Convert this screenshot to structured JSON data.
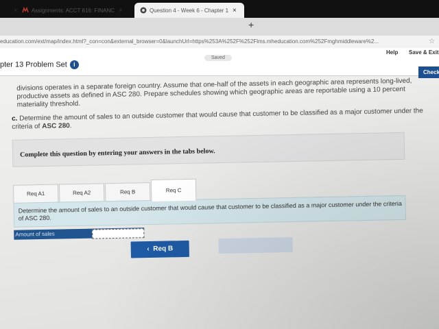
{
  "browser": {
    "tabs": [
      {
        "label": "Assignments: ACCT 616: FINANC"
      },
      {
        "label": "Question 4 - Week 6 - Chapter 1"
      }
    ],
    "new_tab": "+",
    "close": "×",
    "url": "education.com/ext/map/index.html?_con=con&external_browser=0&launchUrl=https%253A%252F%252Flms.mheducation.com%252Fmghmiddleware%2..."
  },
  "app": {
    "title": "pter 13 Problem Set",
    "saved": "Saved",
    "help": "Help",
    "save_exit": "Save & Exit",
    "check": "Check"
  },
  "problem": {
    "paragraph": "divisions operates in a separate foreign country. Assume that one-half of the assets in each geographic area represents long-lived, productive assets as defined in ASC 280. Prepare schedules showing which geographic areas are reportable using a 10 percent materiality threshold.",
    "part_c_label": "c.",
    "part_c_text": "Determine the amount of sales to an outside customer that would cause that customer to be classified as a major customer under the criteria of",
    "part_c_bold": "ASC 280",
    "part_c_end": ".",
    "instruction": "Complete this question by entering your answers in the tabs below."
  },
  "answer_tabs": [
    {
      "label": "Req A1"
    },
    {
      "label": "Req A2"
    },
    {
      "label": "Req B"
    },
    {
      "label": "Req C"
    }
  ],
  "question": {
    "text": "Determine the amount of sales to an outside customer that would cause that customer to be classified as a major customer under the criteria of ASC 280.",
    "amount_label": "Amount of sales",
    "amount_value": ""
  },
  "nav": {
    "prev_label": "Req B",
    "next_label": ""
  },
  "colors": {
    "accent": "#1d4f91",
    "question_bg": "#d4e6ea"
  }
}
